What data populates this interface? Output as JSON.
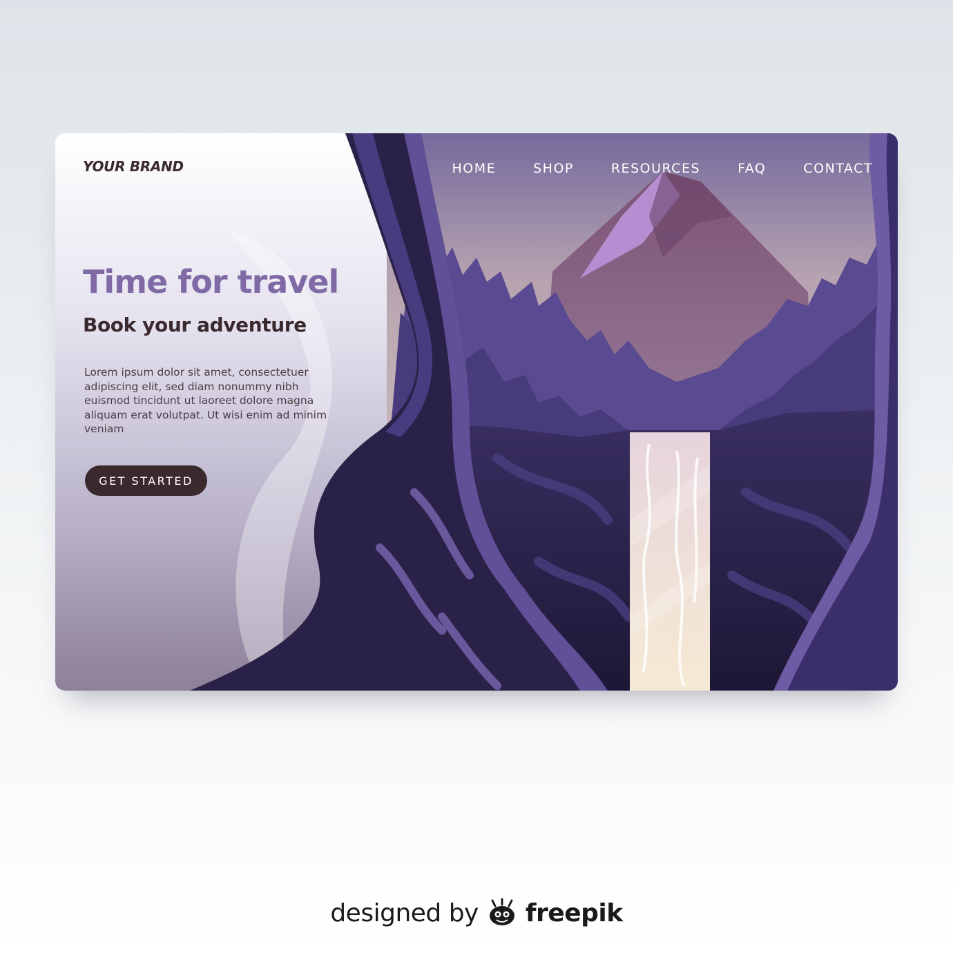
{
  "brand": "YOUR BRAND",
  "nav": [
    "HOME",
    "SHOP",
    "RESOURCES",
    "FAQ",
    "CONTACT"
  ],
  "hero": {
    "title": "Time for travel",
    "subtitle": "Book your adventure",
    "body": "Lorem ipsum dolor sit amet, consectetuer adipiscing elit, sed diam nonummy nibh euismod tincidunt ut laoreet dolore magna aliquam erat volutpat. Ut wisi enim ad minim veniam",
    "cta": "GET STARTED"
  },
  "credit": {
    "prefix": "designed by",
    "name": "freepik"
  },
  "colors": {
    "accent": "#7f6aa6",
    "dark": "#3b2a2d",
    "deep_purple": "#2a2148"
  }
}
